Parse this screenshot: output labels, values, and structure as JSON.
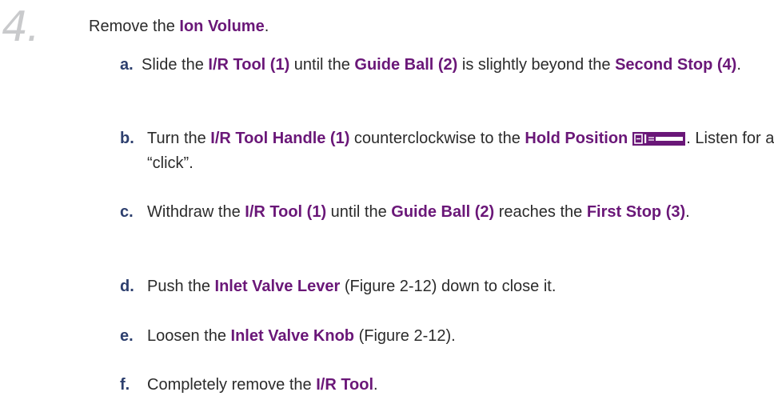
{
  "step": {
    "number": "4",
    "suffix": ".",
    "title_prefix": "Remove the ",
    "title_highlight": "Ion Volume",
    "title_suffix": "."
  },
  "substeps": {
    "a": {
      "letter": "a.",
      "t1": "Slide the ",
      "h1": "I/R Tool (1)",
      "t2": " until the ",
      "h2": "Guide Ball (2)",
      "t3": " is slightly beyond the ",
      "h3": "Second Stop (4)",
      "t4": "."
    },
    "b": {
      "letter": "b.",
      "t1": "Turn the ",
      "h1": "I/R Tool Handle (1)",
      "t2": " counterclockwise to the ",
      "h2": "Hold Position",
      "icon": "hold-position-icon",
      "t3": ". Listen for a “click”."
    },
    "c": {
      "letter": "c.",
      "t1": "Withdraw the ",
      "h1": "I/R Tool (1)",
      "t2": " until the ",
      "h2": "Guide Ball (2)",
      "t3": " reaches the ",
      "h3": "First Stop (3)",
      "t4": "."
    },
    "d": {
      "letter": "d.",
      "t1": "Push the ",
      "h1": "Inlet Valve Lever",
      "t2": " (Figure 2-12) down to close it."
    },
    "e": {
      "letter": "e.",
      "t1": "Loosen the ",
      "h1": "Inlet Valve Knob",
      "t2": " (Figure 2-12)."
    },
    "f": {
      "letter": "f.",
      "t1": "Completely remove the ",
      "h1": "I/R Tool",
      "t2": "."
    }
  },
  "colors": {
    "highlight": "#6a1778",
    "letter": "#2d3f6e",
    "step_number": "#c9cacc",
    "text": "#2b2b2b"
  }
}
